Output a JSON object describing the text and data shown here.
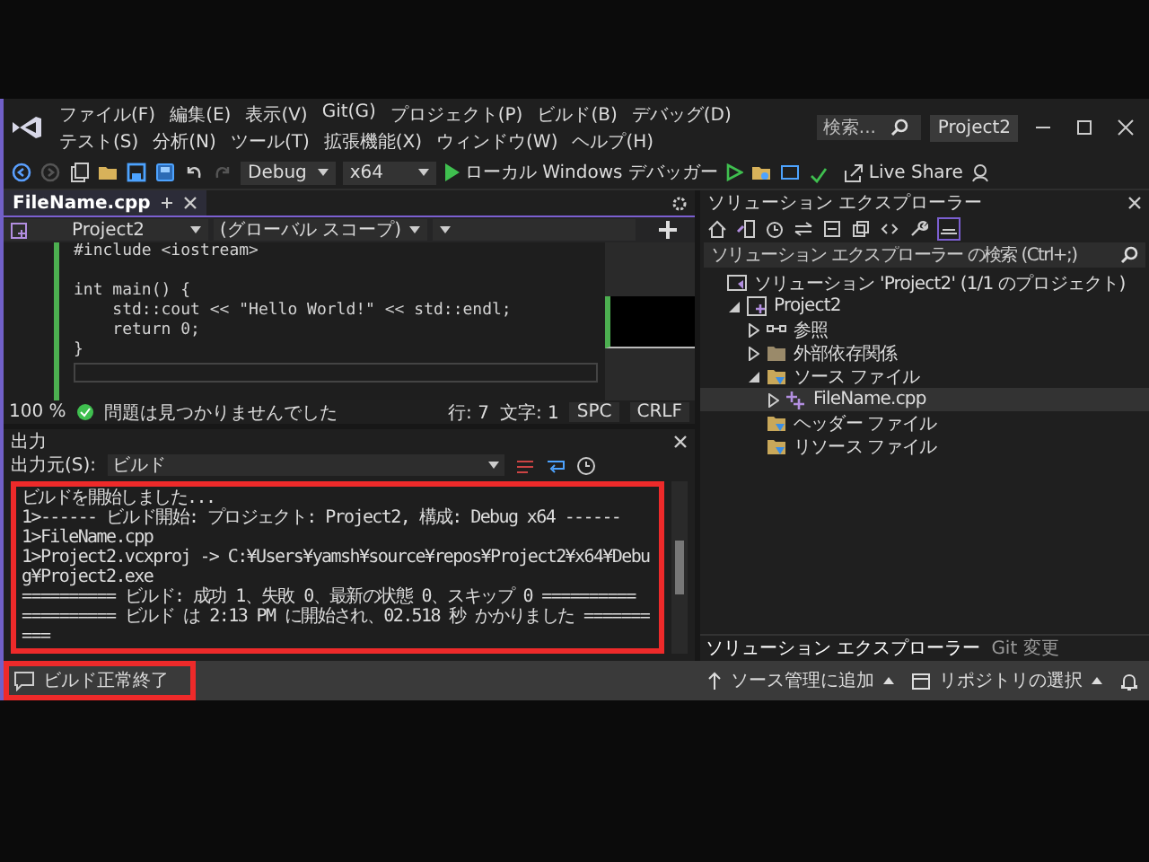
{
  "menu": {
    "items": [
      "ファイル(F)",
      "編集(E)",
      "表示(V)",
      "Git(G)",
      "プロジェクト(P)",
      "ビルド(B)",
      "デバッグ(D)",
      "テスト(S)",
      "分析(N)",
      "ツール(T)",
      "拡張機能(X)",
      "ウィンドウ(W)",
      "ヘルプ(H)"
    ],
    "search": {
      "placeholder": "検索..."
    },
    "project_badge": "Project2"
  },
  "toolbar": {
    "configuration": "Debug",
    "platform": "x64",
    "run_target": "ローカル Windows デバッガー",
    "live_share": "Live Share"
  },
  "editor": {
    "tab": {
      "label": "FileName.cpp",
      "selected": true
    },
    "nav": {
      "project": "Project2",
      "scope": "(グローバル スコープ)"
    },
    "code_lines": [
      {
        "text": "#include <iostream>",
        "blank_after": true
      },
      {
        "text": "int main() {",
        "blank_after": false
      },
      {
        "text": "    std::cout << \"Hello World!\" << std::endl;",
        "blank_after": false
      },
      {
        "text": "    return 0;",
        "blank_after": false
      },
      {
        "text": "}",
        "blank_after": false
      }
    ],
    "status": {
      "zoom": "100 %",
      "issues": "問題は見つかりませんでした",
      "line": "行: 7",
      "column": "文字: 1",
      "indent": "SPC",
      "line_ending": "CRLF"
    }
  },
  "output": {
    "title": "出力",
    "source_label": "出力元(S):",
    "source": "ビルド",
    "lines": [
      "ビルドを開始しました...",
      "1>------ ビルド開始: プロジェクト: Project2, 構成: Debug x64 ------",
      "1>FileName.cpp",
      "1>Project2.vcxproj -> C:¥Users¥yamsh¥source¥repos¥Project2¥x64¥Debug¥Project2.exe",
      "========== ビルド: 成功 1、失敗 0、最新の状態 0、スキップ 0 ==========",
      "========== ビルド は 2:13 PM に開始され、02.518 秒 かかりました =========="
    ]
  },
  "solution_explorer": {
    "title": "ソリューション エクスプローラー",
    "search": {
      "placeholder": "ソリューション エクスプローラー の検索 (Ctrl+;)"
    },
    "tree": [
      {
        "label": "ソリューション 'Project2' (1/1 のプロジェクト)",
        "kind": "solution",
        "selected": false,
        "children": [
          {
            "label": "Project2",
            "kind": "project",
            "expanded": true,
            "selected": false,
            "children": [
              {
                "label": "参照",
                "kind": "references",
                "expanded": false,
                "selected": false
              },
              {
                "label": "外部依存関係",
                "kind": "folder",
                "expanded": false,
                "selected": false
              },
              {
                "label": "ソース ファイル",
                "kind": "filter",
                "expanded": true,
                "selected": false,
                "children": [
                  {
                    "label": "FileName.cpp",
                    "kind": "file",
                    "expanded": false,
                    "selected": true
                  }
                ]
              },
              {
                "label": "ヘッダー ファイル",
                "kind": "filter",
                "selected": false
              },
              {
                "label": "リソース ファイル",
                "kind": "filter",
                "selected": false
              }
            ]
          }
        ]
      }
    ],
    "tabs": [
      {
        "label": "ソリューション エクスプローラー",
        "selected": true
      },
      {
        "label": "Git 変更",
        "selected": false
      }
    ]
  },
  "status_bar": {
    "message": "ビルド正常終了",
    "source_control": "ソース管理に追加",
    "repository": "リポジトリの選択"
  }
}
